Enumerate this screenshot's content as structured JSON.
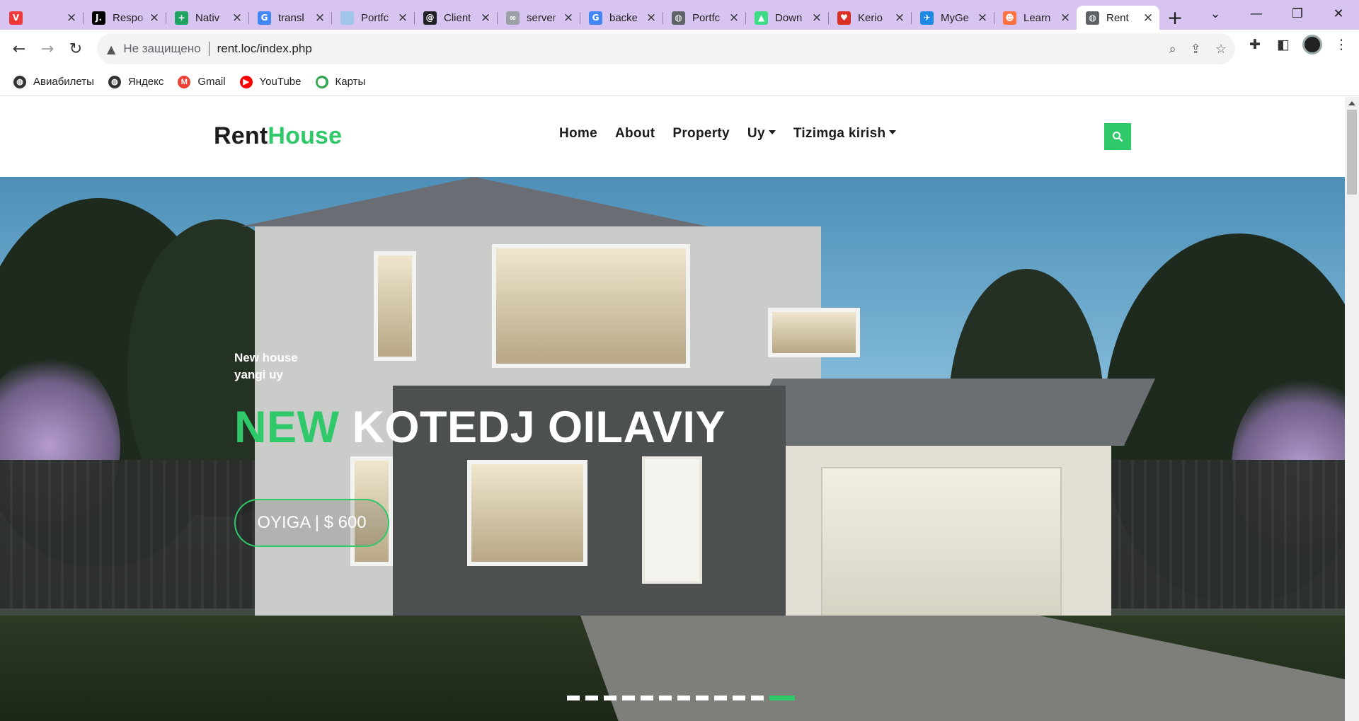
{
  "browser": {
    "tabs": [
      {
        "title": "",
        "favicon": "vivaldi-icon",
        "color": "#ef3939",
        "glyph": "V"
      },
      {
        "title": "Respo",
        "favicon": "j-icon",
        "color": "#000000",
        "glyph": "J."
      },
      {
        "title": "Nativ",
        "favicon": "plus-square-icon",
        "color": "#1ea362",
        "glyph": "+"
      },
      {
        "title": "transl",
        "favicon": "google-icon",
        "color": "#4285f4",
        "glyph": "G"
      },
      {
        "title": "Portfc",
        "favicon": "image-icon",
        "color": "#9fc5e8",
        "glyph": ""
      },
      {
        "title": "Client",
        "favicon": "at-icon",
        "color": "#202124",
        "glyph": "@"
      },
      {
        "title": "server",
        "favicon": "link-icon",
        "color": "#9aa0a6",
        "glyph": "∞"
      },
      {
        "title": "backe",
        "favicon": "google-icon",
        "color": "#4285f4",
        "glyph": "G"
      },
      {
        "title": "Portfc",
        "favicon": "globe-icon",
        "color": "#5f6368",
        "glyph": "◍"
      },
      {
        "title": "Down",
        "favicon": "android-icon",
        "color": "#3ddc84",
        "glyph": "▲"
      },
      {
        "title": "Kerio",
        "favicon": "shield-icon",
        "color": "#d93025",
        "glyph": "♥"
      },
      {
        "title": "MyGe",
        "favicon": "bird-icon",
        "color": "#1e88e5",
        "glyph": "✈"
      },
      {
        "title": "Learn",
        "favicon": "avatar-icon",
        "color": "#ff7043",
        "glyph": "☻"
      },
      {
        "title": "Rent",
        "favicon": "globe-icon",
        "color": "#5f6368",
        "glyph": "◍",
        "active": true
      }
    ],
    "window_controls": {
      "collapse": "⌄",
      "minimize": "—",
      "restore": "❐",
      "close": "✕"
    },
    "toolbar": {
      "back": "←",
      "forward": "→",
      "reload": "↻",
      "security_label": "Не защищено",
      "url": "rent.loc/index.php"
    },
    "bookmarks": [
      {
        "label": "Авиабилеты",
        "icon": "globe-icon",
        "color": "#333333",
        "glyph": "◍"
      },
      {
        "label": "Яндекс",
        "icon": "globe-icon",
        "color": "#333333",
        "glyph": "◍"
      },
      {
        "label": "Gmail",
        "icon": "gmail-icon",
        "color": "#ea4335",
        "glyph": "M"
      },
      {
        "label": "YouTube",
        "icon": "youtube-icon",
        "color": "#ff0000",
        "glyph": "▶"
      },
      {
        "label": "Карты",
        "icon": "maps-pin-icon",
        "color": "#34a853",
        "glyph": "⬤"
      }
    ]
  },
  "site": {
    "logo": {
      "part1": "Rent",
      "part2": "House"
    },
    "nav": [
      {
        "label": "Home",
        "dropdown": false
      },
      {
        "label": "About",
        "dropdown": false
      },
      {
        "label": "Property",
        "dropdown": false
      },
      {
        "label": "Uy",
        "dropdown": true
      },
      {
        "label": "Tizimga kirish",
        "dropdown": true
      }
    ],
    "accent_color": "#2fc96a",
    "hero": {
      "subtitle_line1": "New house",
      "subtitle_line2": "yangi uy",
      "title_accent": "NEW",
      "title_rest": "KOTEDJ OILAVIY",
      "price_button": "OYIGA | $ 600",
      "slides_count": 12,
      "active_slide": 12
    }
  }
}
